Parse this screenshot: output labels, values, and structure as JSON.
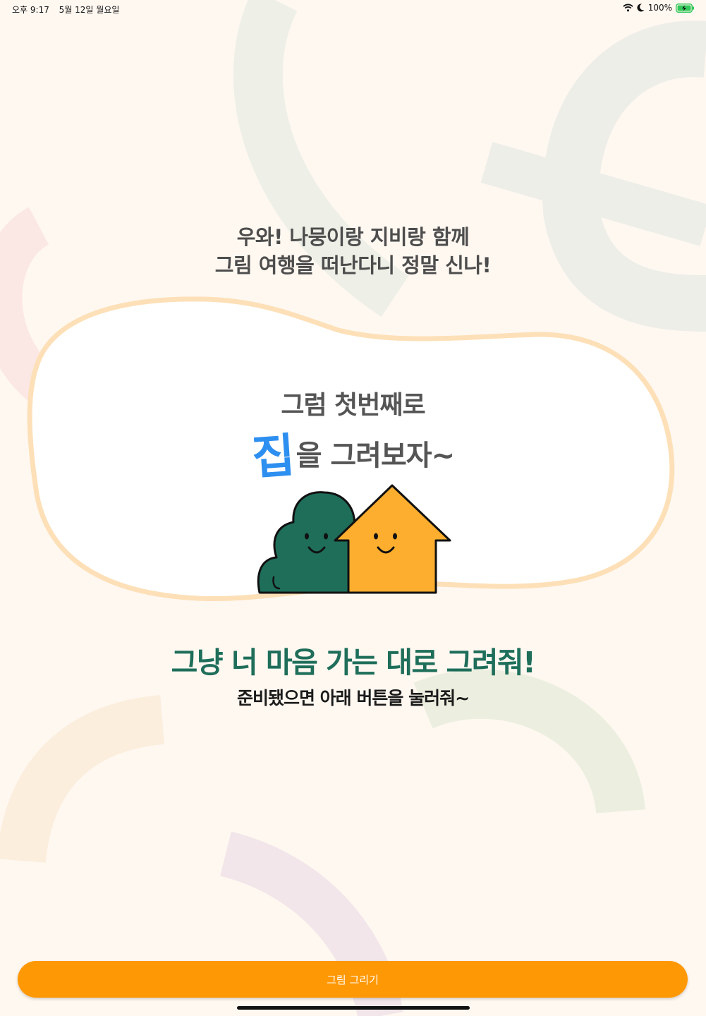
{
  "status_bar": {
    "time": "오후 9:17",
    "date": "5월 12일 월요일",
    "battery": "100%"
  },
  "intro": {
    "line1": "우와! 나뭉이랑 지비랑 함께",
    "line2": "그림 여행을 떠난다니 정말 신나!"
  },
  "prompt": {
    "line1": "그럼 첫번째로",
    "highlight": "집",
    "line2_rest": "을 그려보자~"
  },
  "headline": "그냥 너 마음 가는 대로 그려줘!",
  "subline": "준비됐으면 아래 버튼을 눌러줘~",
  "button": {
    "label": "그림 그리기"
  },
  "colors": {
    "background": "#fff8f1",
    "blob_border": "#fde0b8",
    "highlight": "#2d8ff0",
    "headline": "#1e6e5a",
    "tree": "#1e6e5a",
    "house": "#fdae2e",
    "button": "#ff9805"
  },
  "icons": [
    "wifi-icon",
    "moon-icon",
    "battery-charging-icon"
  ]
}
